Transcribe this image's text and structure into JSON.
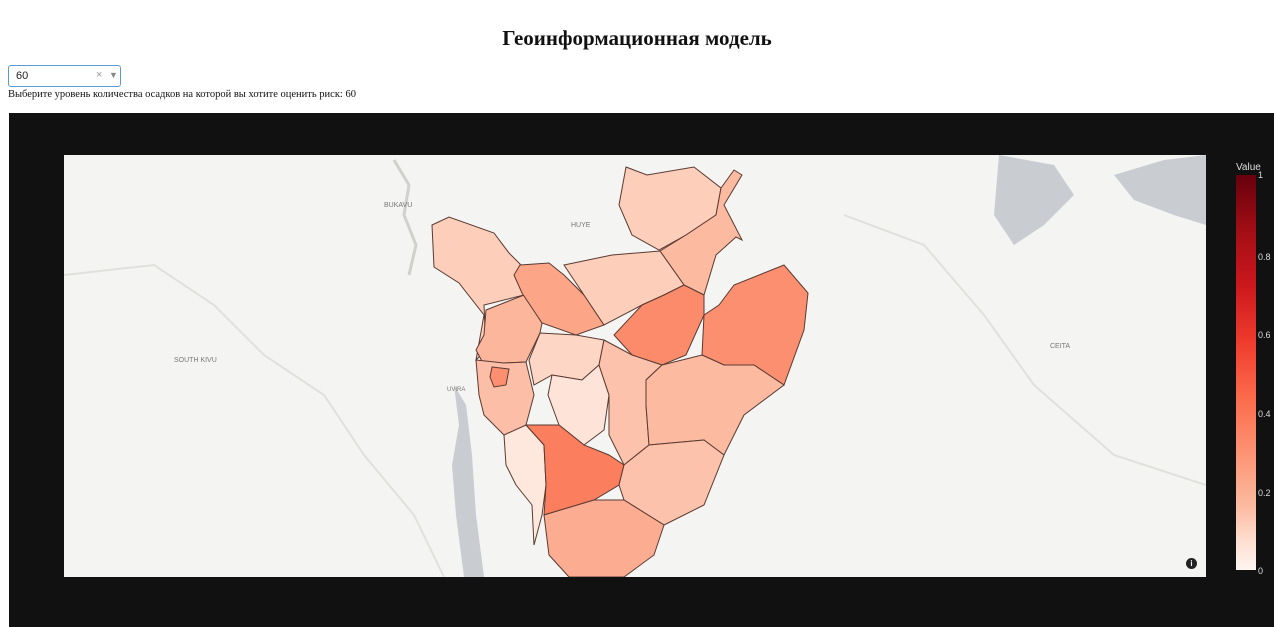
{
  "header": {
    "title": "Геоинформационная модель"
  },
  "dropdown": {
    "value": "60",
    "clear_glyph": "×",
    "arrow_glyph": "▼"
  },
  "help_text": "Выберите уровень количества осадков на которой вы хотите оценить риск: 60",
  "map": {
    "place_labels": {
      "bukavu": "BUKAVU",
      "huye": "HUYE",
      "south_kivu": "SOUTH KIVU",
      "uvira": "UVIRA",
      "ceita": "CEITA"
    },
    "colorscale": "Reds",
    "provinces": [
      {
        "id": "kirundo",
        "value": 0.17
      },
      {
        "id": "muyinga",
        "value": 0.22
      },
      {
        "id": "cibitoke",
        "value": 0.17
      },
      {
        "id": "bubanza",
        "value": 0.23
      },
      {
        "id": "kayanza",
        "value": 0.27
      },
      {
        "id": "ngozi",
        "value": 0.17
      },
      {
        "id": "karuzi",
        "value": 0.33
      },
      {
        "id": "cankuzo",
        "value": 0.32
      },
      {
        "id": "bujumbura-rural",
        "value": 0.21
      },
      {
        "id": "bujumbura-mairie",
        "value": 0.32
      },
      {
        "id": "muramvya",
        "value": 0.15
      },
      {
        "id": "mwaro",
        "value": 0.1
      },
      {
        "id": "gitega",
        "value": 0.2
      },
      {
        "id": "ruyigi",
        "value": 0.22
      },
      {
        "id": "rumonge",
        "value": 0.08
      },
      {
        "id": "bururi",
        "value": 0.36
      },
      {
        "id": "rutana",
        "value": 0.2
      },
      {
        "id": "makamba",
        "value": 0.25
      }
    ],
    "info_glyph": "i"
  },
  "colorbar": {
    "title": "Value",
    "ticks": [
      "1",
      "0.8",
      "0.6",
      "0.4",
      "0.2",
      "0"
    ]
  }
}
